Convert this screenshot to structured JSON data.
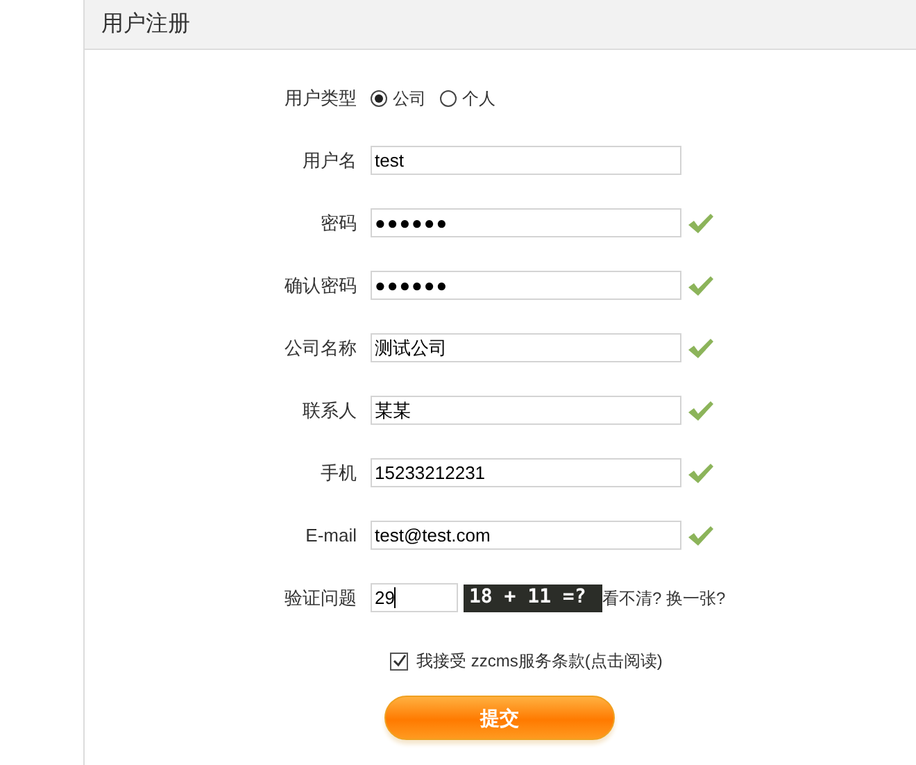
{
  "panel": {
    "title": "用户注册"
  },
  "fields": [
    {
      "kind": "radio",
      "label": "用户类型",
      "options": [
        {
          "label": "公司",
          "selected": true
        },
        {
          "label": "个人",
          "selected": false
        }
      ]
    },
    {
      "kind": "text",
      "label": "用户名",
      "value": "test",
      "valid": false
    },
    {
      "kind": "password",
      "label": "密码",
      "value": "●●●●●●",
      "valid": true
    },
    {
      "kind": "password",
      "label": "确认密码",
      "value": "●●●●●●",
      "valid": true
    },
    {
      "kind": "text",
      "label": "公司名称",
      "value": "测试公司",
      "valid": true
    },
    {
      "kind": "text",
      "label": "联系人",
      "value": "某某",
      "valid": true
    },
    {
      "kind": "text",
      "label": "手机",
      "value": "15233212231",
      "valid": true
    },
    {
      "kind": "text",
      "label": "E-mail",
      "value": "test@test.com",
      "valid": true
    },
    {
      "kind": "captcha",
      "label": "验证问题",
      "value": "29",
      "question": "18 + 11 =?",
      "refresh_link": "看不清? 换一张?"
    }
  ],
  "agreement": {
    "checked": true,
    "text": "我接受 zzcms服务条款(点击阅读)"
  },
  "submit": "提交"
}
